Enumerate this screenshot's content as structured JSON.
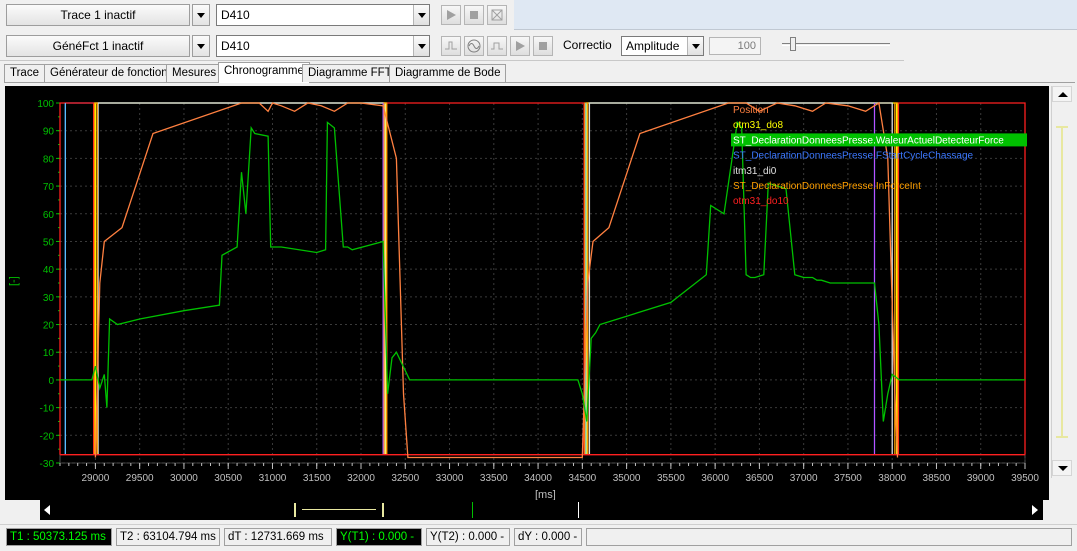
{
  "toolbar": {
    "trace_button": "Trace 1 inactif",
    "trace_device": "D410",
    "genefct_button": "GénéFct 1 inactif",
    "genefct_device": "D410",
    "correction_label": "Correctio",
    "correction_mode": "Amplitude",
    "correction_value": "100"
  },
  "tabs": [
    {
      "label": "Trace"
    },
    {
      "label": "Générateur de fonction"
    },
    {
      "label": "Mesures"
    },
    {
      "label": "Chronogramme"
    },
    {
      "label": "Diagramme FFT"
    },
    {
      "label": "Diagramme de Bode"
    }
  ],
  "active_tab": "Chronogramme",
  "colors": {
    "position": "#ff8040",
    "otm31_do8": "#ffff00",
    "valeur": "#00c000",
    "startcycle": "#3c78ff",
    "itm31_di0": "#e0e0e0",
    "inforce": "#ffa000",
    "otm31_do10": "#ff2020",
    "violet": "#c050ff",
    "cyan": "#60d0ff"
  },
  "chart_data": {
    "type": "line",
    "xlabel": "[ms]",
    "ylabel": "[-]",
    "xlim": [
      28600,
      39500
    ],
    "ylim": [
      -30,
      100
    ],
    "x_ticks": [
      "29000",
      "29500",
      "30000",
      "30500",
      "31000",
      "31500",
      "32000",
      "32500",
      "33000",
      "33500",
      "34000",
      "34500",
      "35000",
      "35500",
      "36000",
      "36500",
      "37000",
      "37500",
      "38000",
      "38500",
      "39000",
      "39500"
    ],
    "y_ticks": [
      "100",
      "90",
      "80",
      "70",
      "60",
      "50",
      "40",
      "30",
      "20",
      "10",
      "0",
      "-10",
      "-20",
      "-30"
    ],
    "legend_position": "top-right",
    "grid": true,
    "legend": [
      {
        "name": "Position",
        "color": "#ff8040"
      },
      {
        "name": "otm31_do8",
        "color": "#ffff00"
      },
      {
        "name": "ST_DeclarationDonneesPresse.WaleurActuelDetecteurForce",
        "color": "#ffffff",
        "highlight": "#00c000"
      },
      {
        "name": "ST_DeclarationDonneesPresse.FStartCycleChassage",
        "color": "#3c78ff"
      },
      {
        "name": "itm31_di0",
        "color": "#e0e0e0"
      },
      {
        "name": "ST_DeclarationDonneesPresse.InForceInt",
        "color": "#ffa000"
      },
      {
        "name": "otm31_do10",
        "color": "#ff2020"
      }
    ],
    "series": [
      {
        "name": "Position",
        "x": [
          29000,
          29050,
          29100,
          29300,
          29650,
          30650,
          30850,
          30950,
          31000,
          31100,
          31250,
          31400,
          31550,
          31700,
          31850,
          32000,
          32250,
          32400,
          32480,
          32530,
          34500,
          34560,
          34620,
          34800,
          35150,
          36150,
          36350,
          36500,
          36700,
          36900,
          37100,
          37250,
          37500,
          37700,
          37850,
          37950,
          38030,
          38060
        ],
        "y": [
          -28,
          35,
          50,
          55,
          89,
          100,
          100,
          97,
          100,
          99,
          97,
          100,
          99,
          97,
          100,
          100,
          99,
          80,
          -5,
          -28,
          -28,
          35,
          50,
          55,
          89,
          100,
          100,
          97,
          100,
          99,
          97,
          100,
          99,
          97,
          100,
          80,
          -5,
          -28
        ]
      },
      {
        "name": "ST_DeclarationDonneesPresse.WaleurActuelDetecteurForce",
        "x": [
          28600,
          28960,
          29000,
          29050,
          29100,
          29130,
          29160,
          29250,
          29500,
          30000,
          30400,
          30430,
          30600,
          30650,
          30700,
          30760,
          30800,
          30950,
          30980,
          31100,
          31500,
          31600,
          31620,
          31700,
          31800,
          31850,
          31900,
          32250,
          32300,
          32350,
          32400,
          32550,
          33000,
          34400,
          34450,
          34500,
          34550,
          34600,
          34650,
          34700,
          35000,
          35500,
          35900,
          35950,
          36100,
          36250,
          36300,
          36350,
          36400,
          36450,
          36550,
          36600,
          36800,
          36900,
          37000,
          37100,
          37150,
          37200,
          37300,
          37500,
          37800,
          37850,
          37900,
          37950,
          38000,
          38080,
          38100,
          39500
        ],
        "y": [
          0,
          0,
          5,
          -3,
          2,
          -10,
          22,
          20,
          22,
          25,
          27,
          45,
          48,
          75,
          60,
          91,
          89,
          88,
          48,
          48,
          46,
          47,
          93,
          91,
          48,
          48,
          47,
          50,
          -5,
          8,
          10,
          0,
          0,
          0,
          0,
          -5,
          -15,
          15,
          17,
          20,
          23,
          28,
          38,
          63,
          60,
          93,
          91,
          38,
          37,
          37,
          38,
          71,
          69,
          38,
          37,
          37,
          36,
          36,
          35,
          35,
          35,
          20,
          -15,
          -5,
          2,
          0,
          0,
          0
        ]
      }
    ],
    "step_series": [
      {
        "name": "ST_DeclarationDonneesPresse.FStartCycleChassage",
        "high_intervals": [
          [
            28660,
            32250
          ],
          [
            34540,
            37800
          ]
        ]
      },
      {
        "name": "otm31_do10",
        "high_intervals": [
          [
            28600,
            28980
          ],
          [
            32290,
            34520
          ],
          [
            38070,
            39500
          ]
        ]
      },
      {
        "name": "otm31_do8",
        "high_intervals": [
          [
            29000,
            32280
          ],
          [
            34550,
            38050
          ]
        ]
      },
      {
        "name": "itm31_di0",
        "high_intervals": [
          [
            29030,
            32270
          ],
          [
            34580,
            38000
          ]
        ]
      },
      {
        "name": "ST_DeclarationDonneesPresse.InForceInt",
        "high_intervals": [
          [
            28990,
            29020
          ],
          [
            32260,
            32290
          ],
          [
            34530,
            34560
          ],
          [
            38030,
            38060
          ]
        ]
      }
    ]
  },
  "scrollbar": {
    "range_label": "[--------]"
  },
  "status": {
    "t1": "T1 : 50373.125 ms",
    "t2": "T2 : 63104.794 ms",
    "dt": "dT : 12731.669 ms",
    "y1": "Y(T1) : 0.000 -",
    "y2": "Y(T2) : 0.000 -",
    "dy": "dY : 0.000 -"
  }
}
